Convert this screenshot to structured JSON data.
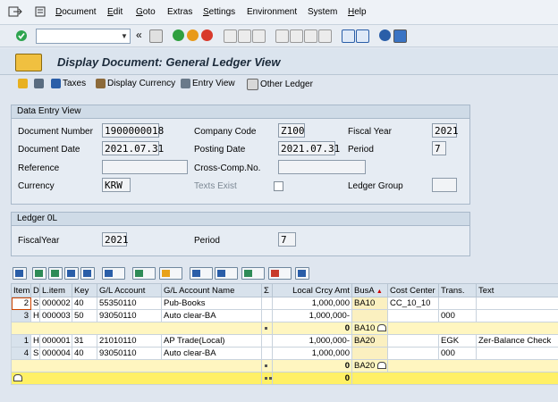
{
  "menu": [
    "Document",
    "Edit",
    "Goto",
    "Extras",
    "Settings",
    "Environment",
    "System",
    "Help"
  ],
  "menu_underline": [
    "D",
    "E",
    "G",
    "",
    "S",
    "",
    "",
    "H"
  ],
  "toolbar": {
    "command_value": "",
    "back_chevron": "«"
  },
  "title": "Display Document: General Ledger View",
  "app_toolbar": {
    "taxes": "Taxes",
    "display_currency": "Display Currency",
    "entry_view": "Entry View",
    "other_ledger": "Other Ledger"
  },
  "data_entry": {
    "header": "Data Entry View",
    "document_number_label": "Document Number",
    "document_number": "1900000018",
    "company_code_label": "Company Code",
    "company_code": "Z100",
    "fiscal_year_label": "Fiscal Year",
    "fiscal_year": "2021",
    "document_date_label": "Document Date",
    "document_date": "2021.07.31",
    "posting_date_label": "Posting Date",
    "posting_date": "2021.07.31",
    "period_label": "Period",
    "period": "7",
    "reference_label": "Reference",
    "reference": "",
    "cross_comp_label": "Cross-Comp.No.",
    "cross_comp": "",
    "currency_label": "Currency",
    "currency": "KRW",
    "texts_exist_label": "Texts Exist",
    "ledger_group_label": "Ledger Group",
    "ledger_group": ""
  },
  "ledger": {
    "header": "Ledger 0L",
    "fiscal_year_label": "FiscalYear",
    "fiscal_year": "2021",
    "period_label": "Period",
    "period": "7"
  },
  "grid": {
    "columns": [
      "Item",
      "D",
      "L.item",
      "Key",
      "G/L Account",
      "G/L Account Name",
      "Σ",
      "Local Crcy Amt",
      "BusA",
      "Cost Center",
      "Trans.",
      "Text"
    ],
    "rows": [
      {
        "item": "2",
        "d": "S",
        "litem": "000002",
        "key": "40",
        "gl": "55350110",
        "name": "Pub-Books",
        "amt": "1,000,000",
        "busa": "BA10",
        "cc": "CC_10_10",
        "trans": "",
        "text": ""
      },
      {
        "item": "3",
        "d": "H",
        "litem": "000003",
        "key": "50",
        "gl": "93050110",
        "name": "Auto clear-BA",
        "amt": "1,000,000-",
        "busa": "",
        "cc": "",
        "trans": "000",
        "text": ""
      },
      {
        "subtotal": true,
        "amt": "0",
        "busa": "BA10"
      },
      {
        "item": "1",
        "d": "H",
        "litem": "000001",
        "key": "31",
        "gl": "21010110",
        "name": "AP Trade(Local)",
        "amt": "1,000,000-",
        "busa": "BA20",
        "cc": "",
        "trans": "EGK",
        "text": "Zer-Balance Check"
      },
      {
        "item": "4",
        "d": "S",
        "litem": "000004",
        "key": "40",
        "gl": "93050110",
        "name": "Auto clear-BA",
        "amt": "1,000,000",
        "busa": "",
        "cc": "",
        "trans": "000",
        "text": ""
      },
      {
        "subtotal": true,
        "amt": "0",
        "busa": "BA20"
      },
      {
        "total": true,
        "amt": "0"
      }
    ]
  }
}
